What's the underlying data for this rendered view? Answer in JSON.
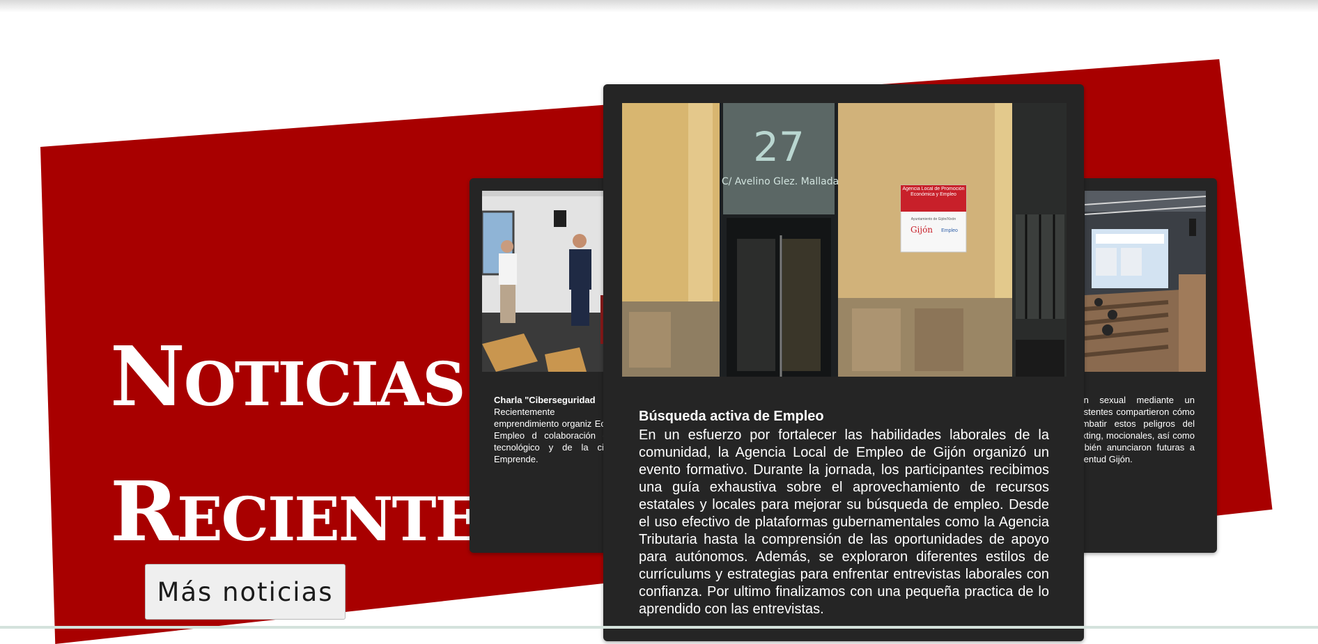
{
  "section": {
    "title_line1_first": "N",
    "title_line1_rest": "OTICIAS",
    "title_line2_first": "R",
    "title_line2_rest": "ECIENTES",
    "more_button": "Más noticias"
  },
  "cards": {
    "left": {
      "title": "Charla \"Ciberseguridad",
      "body": "Recientemente asistimos emprendimiento organiz Económica y Empleo d colaboración de dos e tecnológico y de la cibe Incibe Emprende.",
      "image_icon": "people-presenting-photo"
    },
    "center": {
      "title": "Búsqueda activa de Empleo",
      "body": "En un esfuerzo por fortalecer las habilidades laborales de la comunidad, la Agencia Local de Empleo de Gijón organizó un evento formativo. Durante la jornada, los participantes recibimos una guía exhaustiva sobre el aprovechamiento de recursos estatales y locales para mejorar su búsqueda de empleo. Desde el uso efectivo de plataformas gubernamentales como la Agencia Tributaria hasta la comprensión de las oportunidades de apoyo para autónomos. Además, se exploraron diferentes estilos de currículums y estrategias para enfrentar entrevistas laborales con confianza. Por ultimo finalizamos con una pequeña practica de lo aprendido con las entrevistas.",
      "photo": {
        "number": "27",
        "street": "C/ Avelino Glez. Mallada",
        "sign_title": "Agencia Local de Promoción Económica y Empleo",
        "sign_sub": "Ayuntamiento de Gijón/Xixón",
        "sign_brand": "Gijón",
        "sign_brand2": "Empleo"
      }
    },
    "right": {
      "body": "ción sexual mediante un asistentes compartieron cómo combatir estos peligros del sexting, mocionales, así como la bién anunciaron futuras a juventud Gijón.",
      "image_icon": "auditorium-photo"
    }
  },
  "colors": {
    "banner_red": "#a80000",
    "card_dark": "#252525"
  }
}
